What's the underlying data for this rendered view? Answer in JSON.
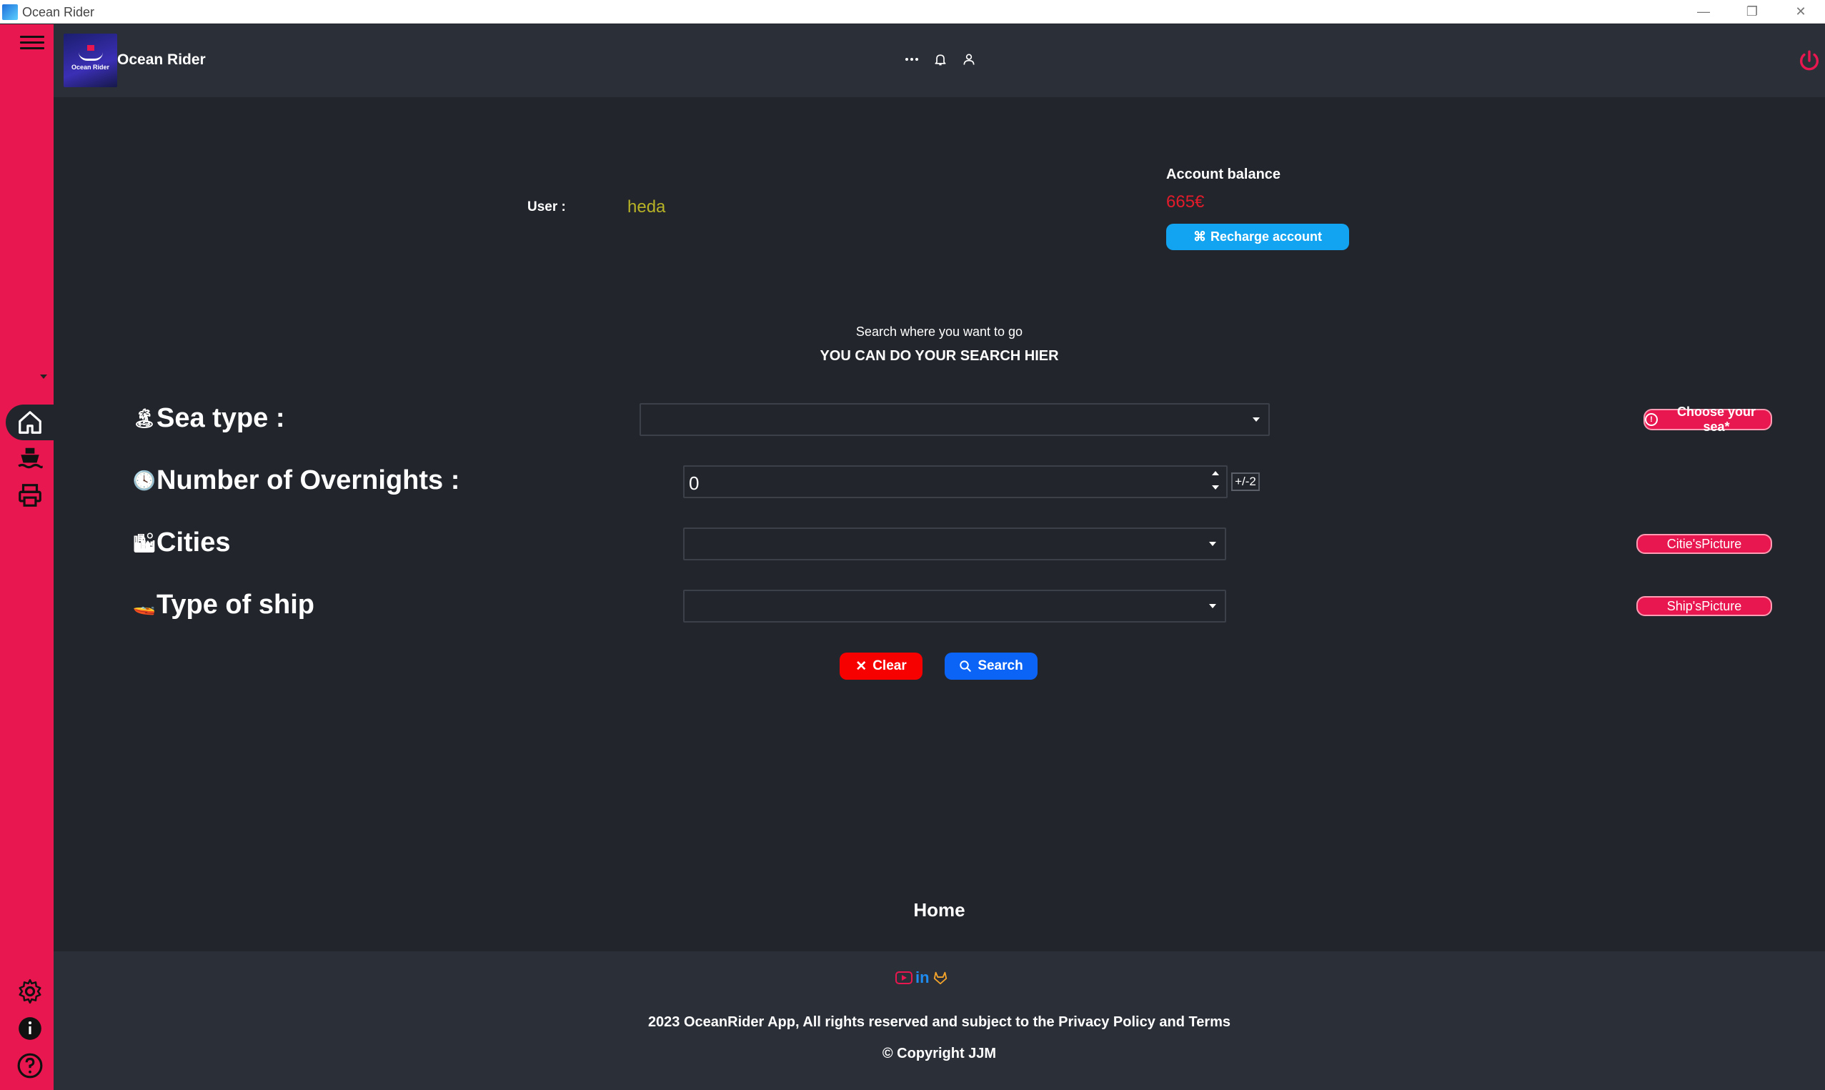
{
  "window": {
    "title": "Ocean Rider",
    "minimize": "—",
    "maximize": "❐",
    "close": "✕"
  },
  "header": {
    "brand": "Ocean Rider",
    "logo_text": "Ocean Rider"
  },
  "account": {
    "user_label": "User :",
    "user_value": "heda",
    "balance_title": "Account balance",
    "balance_value": "665€",
    "recharge_icon": "⌘",
    "recharge_label": "Recharge  account"
  },
  "search": {
    "hint": "Search where you want to go",
    "heading": "YOU CAN DO YOUR SEARCH HIER"
  },
  "form": {
    "sea_type_label": "Sea type :",
    "overnights_label": "Number of Overnights :",
    "overnights_value": "0",
    "overnights_tolerance": "+/-2",
    "cities_label": "Cities",
    "ship_label": "Type of ship",
    "sea_button": "Choose your sea*",
    "sea_button_icon": "!",
    "cities_button": "Citie'sPicture",
    "ship_button": "Ship'sPicture",
    "clear_label": "Clear",
    "clear_icon": "✕",
    "search_label": "Search"
  },
  "icons": {
    "sea_emoji": "🏝",
    "clock_emoji": "🕓",
    "city_emoji": "🏙",
    "ship_emoji": "🚤"
  },
  "page_name": "Home",
  "footer": {
    "rights": "2023 OceanRider App, All rights reserved and subject to the Privacy Policy and Terms",
    "copyright": "©  Copyright JJM",
    "linkedin": "in"
  },
  "colors": {
    "sidebar": "#e8174f",
    "background": "#22262c",
    "appbar": "#2b2f38",
    "recharge": "#12a4f0",
    "clear": "#f60000",
    "search": "#0b64f5",
    "balance": "#e31b2b",
    "user_value": "#b7b226"
  }
}
